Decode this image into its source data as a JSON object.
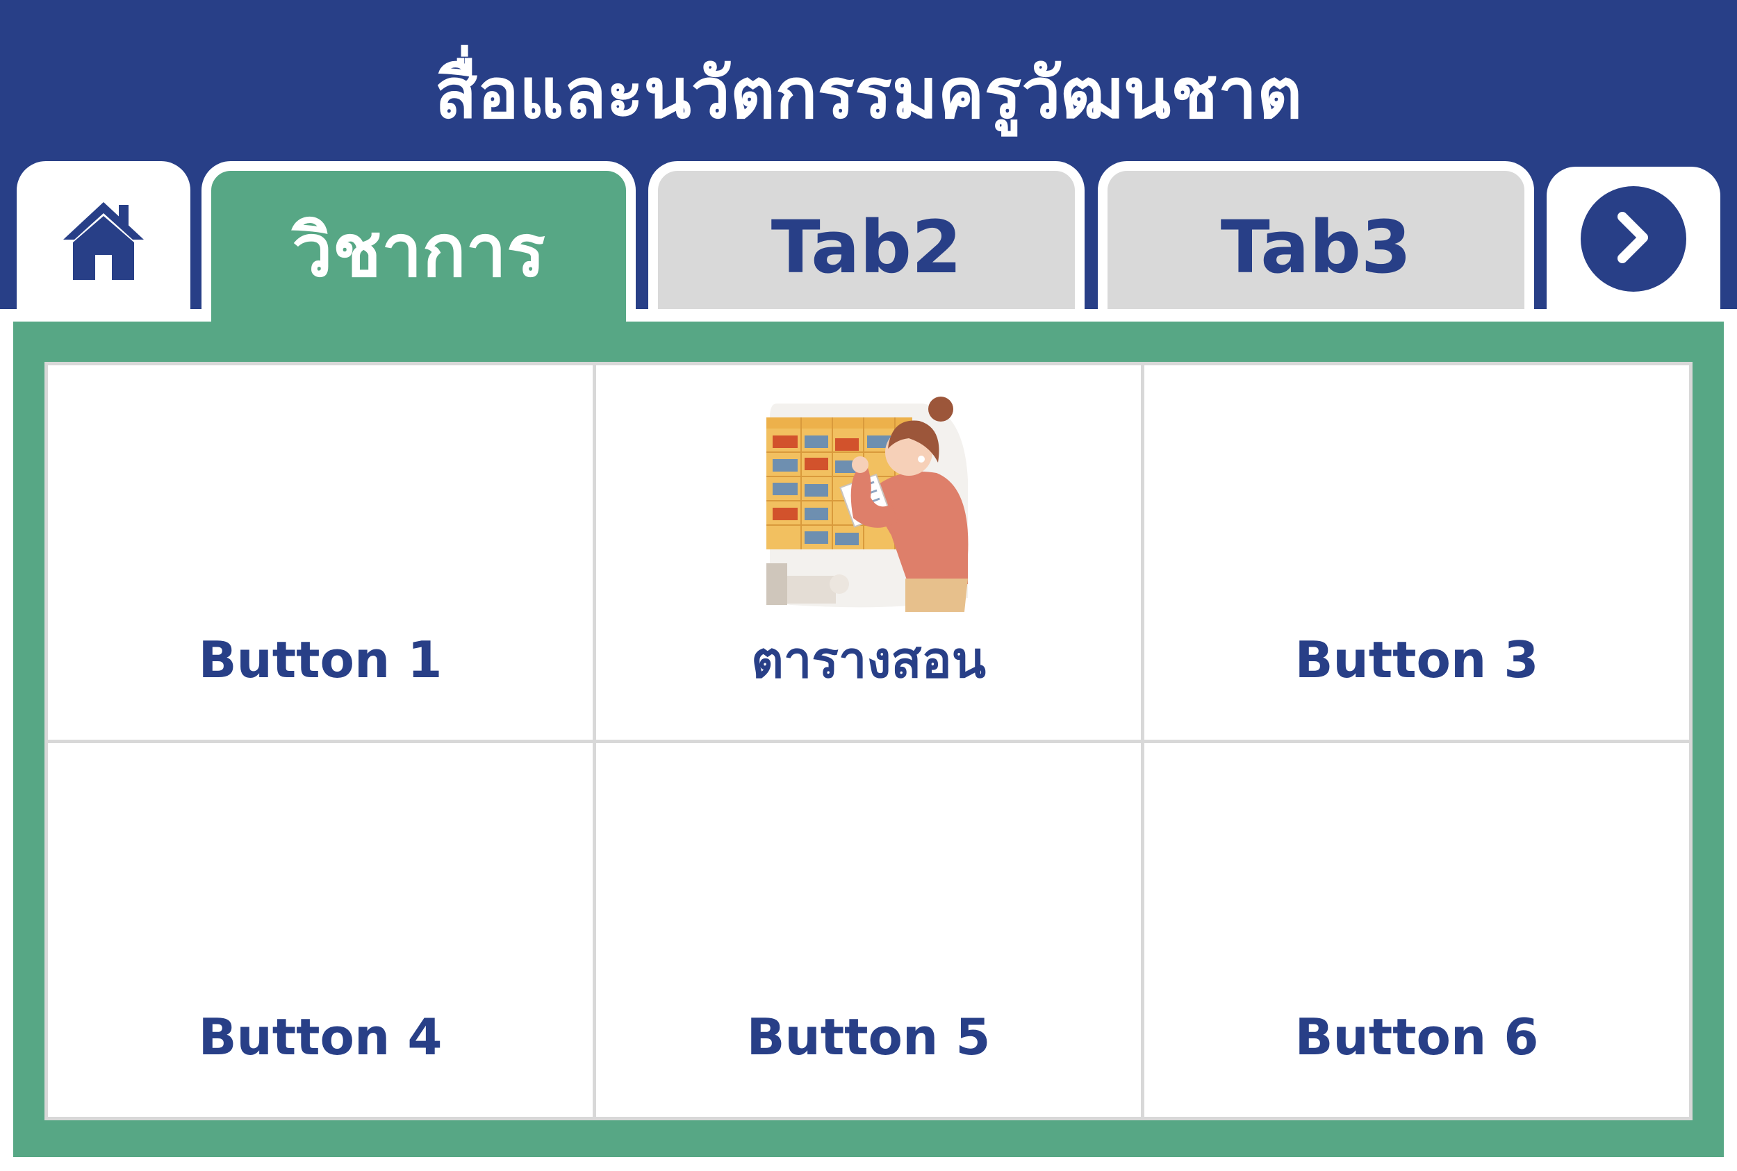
{
  "header": {
    "title": "สื่อและนวัตกรรมครูวัฒนชาต"
  },
  "tabs": {
    "home": {
      "icon": "home-icon"
    },
    "items": [
      {
        "label": "วิชาการ",
        "active": true
      },
      {
        "label": "Tab2",
        "active": false
      },
      {
        "label": "Tab3",
        "active": false
      }
    ],
    "next": {
      "icon": "chevron-right-icon"
    }
  },
  "grid": {
    "buttons": [
      {
        "label": "Button 1"
      },
      {
        "label": "ตารางสอน",
        "icon": "teacher-schedule-illustration"
      },
      {
        "label": "Button 3"
      },
      {
        "label": "Button 4"
      },
      {
        "label": "Button 5"
      },
      {
        "label": "Button 6"
      }
    ]
  },
  "colors": {
    "header_blue": "#283f87",
    "accent_green": "#57a785",
    "inactive_tab": "#d9d9d9",
    "grid_line": "#d8d8d8"
  }
}
